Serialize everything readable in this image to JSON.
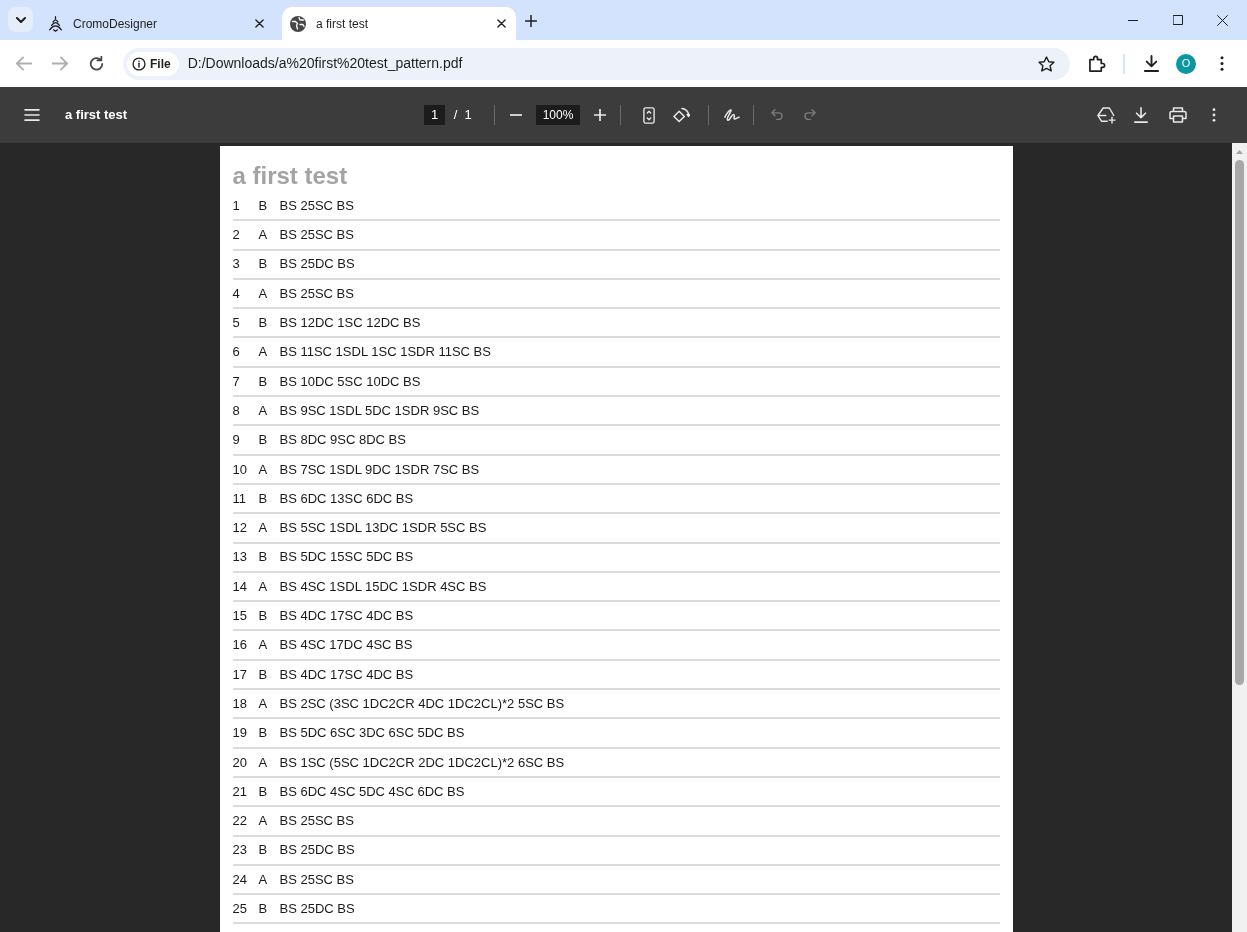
{
  "browser": {
    "tabs": [
      {
        "title": "CromoDesigner",
        "selected": false
      },
      {
        "title": "a first test",
        "selected": true
      }
    ],
    "navigation": {
      "back_disabled": true,
      "forward_disabled": true
    },
    "address_bar": {
      "scheme_chip": "File",
      "url": "D:/Downloads/a%20first%20test_pattern.pdf"
    },
    "profile_initial": "O"
  },
  "pdf_viewer": {
    "title": "a first test",
    "page_field": "1",
    "page_separator": "/",
    "page_count": "1",
    "zoom": "100%",
    "undo_disabled": true,
    "redo_disabled": true
  },
  "document": {
    "heading": "a first test",
    "rows": [
      {
        "number": "1",
        "side": "B",
        "pattern": "BS 25SC BS"
      },
      {
        "number": "2",
        "side": "A",
        "pattern": "BS 25SC BS"
      },
      {
        "number": "3",
        "side": "B",
        "pattern": "BS 25DC BS"
      },
      {
        "number": "4",
        "side": "A",
        "pattern": "BS 25SC BS"
      },
      {
        "number": "5",
        "side": "B",
        "pattern": "BS 12DC 1SC 12DC BS"
      },
      {
        "number": "6",
        "side": "A",
        "pattern": "BS 11SC 1SDL 1SC 1SDR 11SC BS"
      },
      {
        "number": "7",
        "side": "B",
        "pattern": "BS 10DC 5SC 10DC BS"
      },
      {
        "number": "8",
        "side": "A",
        "pattern": "BS 9SC 1SDL 5DC 1SDR 9SC BS"
      },
      {
        "number": "9",
        "side": "B",
        "pattern": "BS 8DC 9SC 8DC BS"
      },
      {
        "number": "10",
        "side": "A",
        "pattern": "BS 7SC 1SDL 9DC 1SDR 7SC BS"
      },
      {
        "number": "11",
        "side": "B",
        "pattern": "BS 6DC 13SC 6DC BS"
      },
      {
        "number": "12",
        "side": "A",
        "pattern": "BS 5SC 1SDL 13DC 1SDR 5SC BS"
      },
      {
        "number": "13",
        "side": "B",
        "pattern": "BS 5DC 15SC 5DC BS"
      },
      {
        "number": "14",
        "side": "A",
        "pattern": "BS 4SC 1SDL 15DC 1SDR 4SC BS"
      },
      {
        "number": "15",
        "side": "B",
        "pattern": "BS 4DC 17SC 4DC BS"
      },
      {
        "number": "16",
        "side": "A",
        "pattern": "BS 4SC 17DC 4SC BS"
      },
      {
        "number": "17",
        "side": "B",
        "pattern": "BS 4DC 17SC 4DC BS"
      },
      {
        "number": "18",
        "side": "A",
        "pattern": "BS 2SC (3SC 1DC2CR 4DC 1DC2CL)*2 5SC BS"
      },
      {
        "number": "19",
        "side": "B",
        "pattern": "BS 5DC 6SC 3DC 6SC 5DC BS"
      },
      {
        "number": "20",
        "side": "A",
        "pattern": "BS 1SC (5SC 1DC2CR 2DC 1DC2CL)*2 6SC BS"
      },
      {
        "number": "21",
        "side": "B",
        "pattern": "BS 6DC 4SC 5DC 4SC 6DC BS"
      },
      {
        "number": "22",
        "side": "A",
        "pattern": "BS 25SC BS"
      },
      {
        "number": "23",
        "side": "B",
        "pattern": "BS 25DC BS"
      },
      {
        "number": "24",
        "side": "A",
        "pattern": "BS 25SC BS"
      },
      {
        "number": "25",
        "side": "B",
        "pattern": "BS 25DC BS"
      }
    ]
  }
}
